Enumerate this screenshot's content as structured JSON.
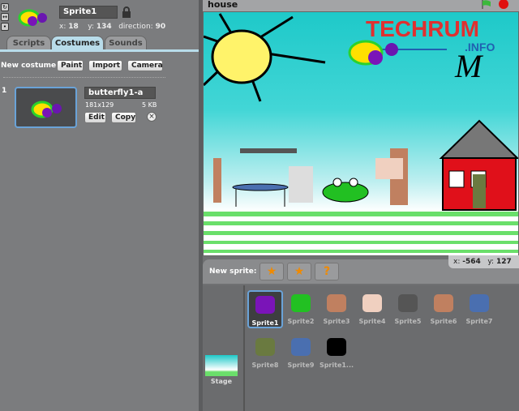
{
  "sprite": {
    "name": "Sprite1",
    "x_label": "x:",
    "x": "18",
    "y_label": "y:",
    "y": "134",
    "direction_label": "direction:",
    "direction": "90"
  },
  "tabs": [
    {
      "label": "Scripts"
    },
    {
      "label": "Costumes"
    },
    {
      "label": "Sounds"
    }
  ],
  "active_tab": "Costumes",
  "costumes": {
    "new_label": "New costume:",
    "buttons": [
      "Paint",
      "Import",
      "Camera"
    ],
    "items": [
      {
        "index": "1",
        "name": "butterfly1-a",
        "size": "181x129",
        "filesize": "5 KB",
        "edit": "Edit",
        "copy": "Copy"
      }
    ]
  },
  "stage": {
    "title": "house",
    "watermark": "TECHRUM .INFO"
  },
  "new_sprite_label": "New sprite:",
  "mouse": {
    "x_label": "x:",
    "x": "-564",
    "y_label": "y:",
    "y": "127"
  },
  "sprites": [
    {
      "name": "Sprite1"
    },
    {
      "name": "Sprite2"
    },
    {
      "name": "Sprite3"
    },
    {
      "name": "Sprite4"
    },
    {
      "name": "Sprite5"
    },
    {
      "name": "Sprite6"
    },
    {
      "name": "Sprite7"
    },
    {
      "name": "Sprite8"
    },
    {
      "name": "Sprite9"
    },
    {
      "name": "Sprite1..."
    }
  ],
  "stage_thumb_label": "Stage",
  "colors": {
    "accent": "#b8dcea",
    "selected_border": "#6aa3d8",
    "green_flag": "#3cb83c",
    "stop": "#e01010"
  }
}
